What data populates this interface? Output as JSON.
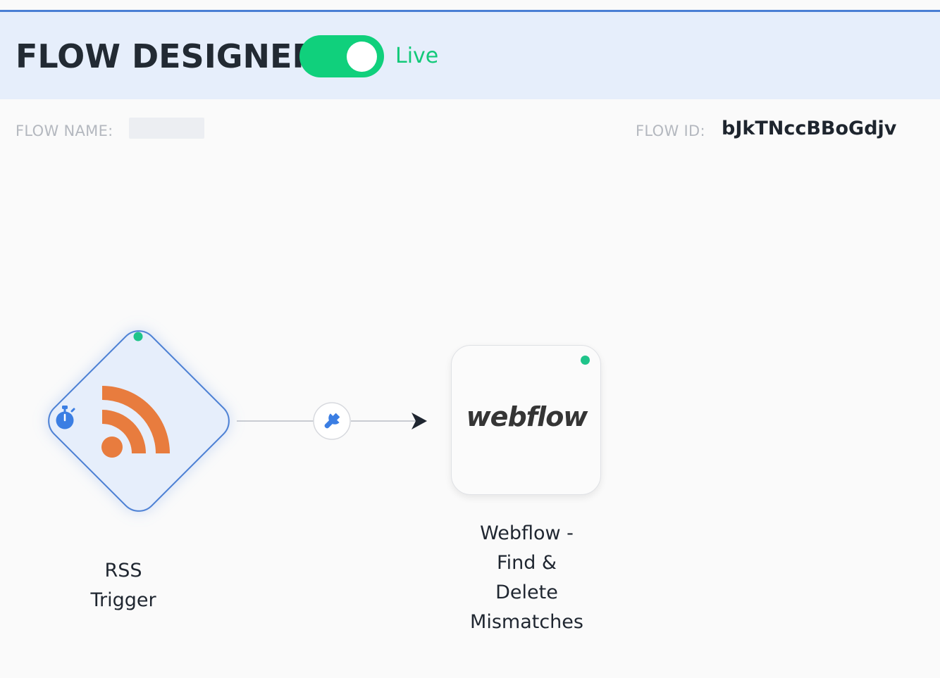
{
  "header": {
    "title": "FLOW DESIGNER",
    "toggle_state": "on",
    "status_label": "Live"
  },
  "meta": {
    "flow_name_label": "FLOW NAME:",
    "flow_name_value": "",
    "flow_id_label": "FLOW ID:",
    "flow_id_value": "bJkTNccBBoGdjv"
  },
  "nodes": [
    {
      "id": "rss",
      "label": "RSS\nTrigger",
      "icon": "rss-icon",
      "badge_icon": "stopwatch-icon",
      "status": "active"
    },
    {
      "id": "webflow",
      "label": "Webflow -\nFind &\nDelete\nMismatches",
      "logo_text": "webflow",
      "status": "active"
    }
  ],
  "connector": {
    "icon": "wrench-icon",
    "arrow_icon": "arrow-right-icon"
  },
  "colors": {
    "accent": "#4a7fd4",
    "header_bg": "#e6eefb",
    "live_green": "#10d07c",
    "status_dot": "#1fc48a",
    "rss_orange": "#e87c3e",
    "icon_blue": "#3b7ee3"
  }
}
